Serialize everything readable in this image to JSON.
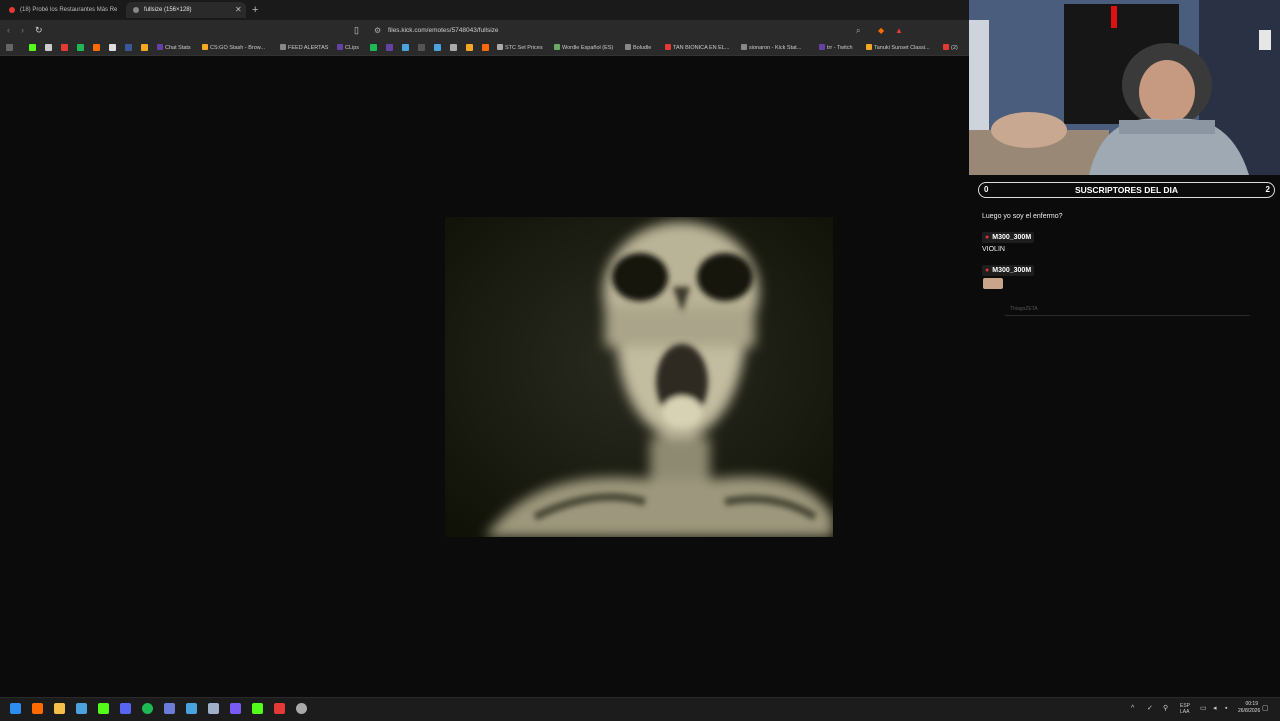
{
  "browser": {
    "tabs": [
      {
        "title": "(18) Probé los Restaurantes Más Re",
        "active": false
      },
      {
        "title": "fullsize (156×128)",
        "active": true
      }
    ],
    "url": "files.kick.com/emotes/5748043/fullsize",
    "bookmarks": [
      "Chat Stats",
      "CS:GO Stash - Brow...",
      "FEED ALERTAS",
      "CLips",
      "STC Set Prices",
      "Wordle Español (ES)",
      "Boludle",
      "TAN BIONICA EN EL...",
      "sionaron - Kick Stat...",
      "trr - Twitch",
      "Tanuki Sunset Classi...",
      "(2)"
    ]
  },
  "overlay": {
    "subs_title": "SUSCRIPTORES DEL DIA",
    "subs_left": "0",
    "subs_right": "2",
    "messages": [
      {
        "text": "Luego yo soy el enfermo?"
      },
      {
        "user": "M300_300M",
        "text": "VIOLIN"
      },
      {
        "user": "M300_300M",
        "text": ""
      }
    ],
    "faded_user": "ThiagoZETA"
  },
  "taskbar": {
    "lang_top": "ESP",
    "lang_bottom": "LAA",
    "time": "00:19",
    "date": "26/8/2026"
  },
  "colors": {
    "accent_red": "#e53935",
    "kick_green": "#53fc18",
    "spotify_green": "#1db954"
  }
}
